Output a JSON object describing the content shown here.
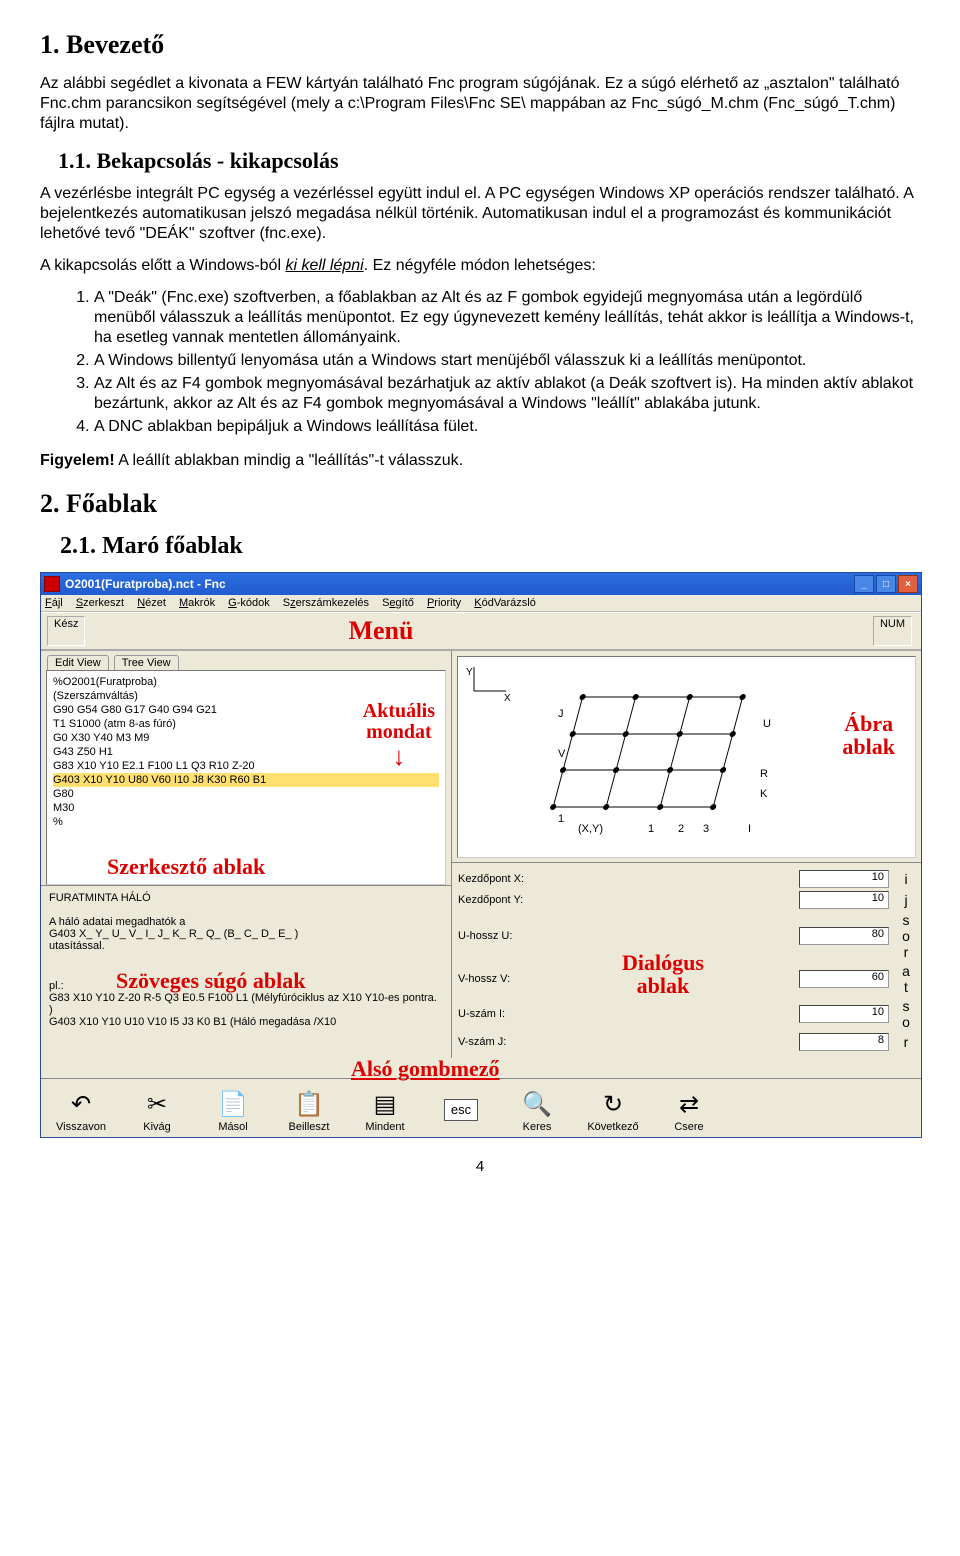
{
  "doc": {
    "h1": "1.  Bevezető",
    "p1": "Az alábbi segédlet a kivonata a FEW kártyán található Fnc program súgójának. Ez a súgó elérhető az „asztalon\" található Fnc.chm parancsikon segítségével (mely a c:\\Program Files\\Fnc SE\\ mappában az Fnc_súgó_M.chm (Fnc_súgó_T.chm) fájlra mutat).",
    "h11": "1.1.  Bekapcsolás - kikapcsolás",
    "p2": "A vezérlésbe integrált PC egység a vezérléssel együtt indul el. A PC egységen Windows XP operációs rendszer található. A bejelentkezés automatikusan jelszó megadása nélkül történik. Automatikusan indul el a programozást és kommunikációt lehetővé tevő \"DEÁK\" szoftver (fnc.exe).",
    "p3_pre": "A kikapcsolás előtt a Windows-ból ",
    "p3_u": "ki kell lépni",
    "p3_post": ". Ez négyféle módon lehetséges:",
    "li1": "A \"Deák\" (Fnc.exe) szoftverben, a főablakban az Alt és az F gombok egyidejű megnyomása után a legördülő menüből válasszuk a leállítás menüpontot. Ez egy úgynevezett kemény leállítás, tehát akkor is leállítja a Windows-t, ha esetleg vannak mentetlen állományaink.",
    "li2": "A Windows billentyű lenyomása után a Windows start menüjéből válasszuk ki a leállítás menüpontot.",
    "li3": "Az Alt és az F4 gombok megnyomásával bezárhatjuk az aktív ablakot (a Deák szoftvert is). Ha minden aktív ablakot bezártunk, akkor az Alt és az F4 gombok megnyomásával a Windows \"leállít\" ablakába jutunk.",
    "li4": "A DNC ablakban bepipáljuk a Windows leállítása fület.",
    "p4_pre": "Figyelem!",
    "p4_post": " A leállít ablakban mindig a \"leállítás\"-t válasszuk.",
    "h2": "2.  Főablak",
    "h21": "2.1.  Maró főablak",
    "pagenum": "4"
  },
  "win": {
    "title": "O2001(Furatproba).nct - Fnc",
    "menus": [
      "Fájl",
      "Szerkeszt",
      "Nézet",
      "Makrók",
      "G-kódok",
      "Szerszámkezelés",
      "Segítő",
      "Priority",
      "KódVarázsló"
    ],
    "status_left": "Kész",
    "status_right": "NUM",
    "menu_annot": "Menü",
    "tabs": [
      "Edit View",
      "Tree View"
    ],
    "code": [
      "%O2001(Furatproba)",
      "(Szerszámváltás)",
      "G90 G54 G80 G17 G40 G94 G21",
      "T1 S1000 (atm 8-as fúró)",
      "G0 X30 Y40 M3 M9",
      "G43 Z50 H1",
      "G83 X10 Y10 E2.1 F100 L1 Q3 R10 Z-20",
      "G403 X10 Y10 U80 V60 I10 J8 K30 R60 B1",
      "G80",
      "M30",
      "%"
    ],
    "code_sel_idx": 7,
    "annot_aktualis": "Aktuális\nmondat",
    "annot_szerk": "Szerkesztő ablak",
    "help": {
      "title": "FURATMINTA HÁLÓ",
      "l1": "A háló adatai megadhatók a",
      "l2": "G403 X_ Y_ U_ V_ I_ J_ K_ R_ Q_ (B_ C_ D_ E_ )",
      "l3": "utasítással.",
      "l4": "pl.:",
      "l5": "G83 X10 Y10 Z-20 R-5 Q3 E0.5 F100 L1  (Mélyfúróciklus az X10 Y10-es pontra. )",
      "l6": "G403 X10 Y10 U10 V10 I5 J3 K0 B1  (Háló megadása /X10",
      "annot": "Szöveges súgó ablak"
    },
    "abra_annot": "Ábra\nablak",
    "dialog": {
      "rows": [
        {
          "label": "Kezdőpont X:",
          "val": "10",
          "side": "i"
        },
        {
          "label": "Kezdőpont Y:",
          "val": "10",
          "side": "j"
        },
        {
          "label": "U-hossz U:",
          "val": "80",
          "side": "s\no\nr"
        },
        {
          "label": "V-hossz V:",
          "val": "60",
          "side": "a\nt"
        },
        {
          "label": "U-szám I:",
          "val": "10",
          "side": "s\no"
        },
        {
          "label": "V-szám J:",
          "val": "8",
          "side": "r"
        }
      ],
      "annot": "Dialógus\nablak"
    },
    "bottom_annot": "Alsó gombmező",
    "buttons": [
      {
        "icon": "↶",
        "label": "Visszavon"
      },
      {
        "icon": "✂",
        "label": "Kivág"
      },
      {
        "icon": "📄",
        "label": "Másol"
      },
      {
        "icon": "📋",
        "label": "Beilleszt"
      },
      {
        "icon": "▤",
        "label": "Mindent"
      },
      {
        "icon": "esc",
        "label": ""
      },
      {
        "icon": "🔍",
        "label": "Keres"
      },
      {
        "icon": "↻",
        "label": "Következő"
      },
      {
        "icon": "⇄",
        "label": "Csere"
      }
    ]
  }
}
